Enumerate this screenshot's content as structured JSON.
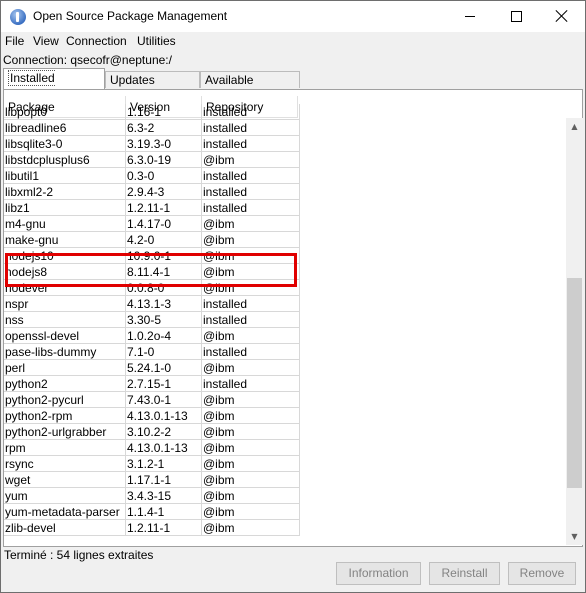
{
  "window": {
    "title": "Open Source Package Management"
  },
  "menu": [
    "File",
    "View",
    "Connection",
    "Utilities"
  ],
  "connection_label": "Connection: qsecofr@neptune:/",
  "tabs": [
    "Installed packages",
    "Updates available",
    "Available packages"
  ],
  "active_tab": "Installed packages",
  "table": {
    "columns": [
      "Package",
      "Version",
      "Repository"
    ],
    "rows": [
      [
        "libpopt0",
        "1.16-1",
        "installed"
      ],
      [
        "libreadline6",
        "6.3-2",
        "installed"
      ],
      [
        "libsqlite3-0",
        "3.19.3-0",
        "installed"
      ],
      [
        "libstdcplusplus6",
        "6.3.0-19",
        "@ibm"
      ],
      [
        "libutil1",
        "0.3-0",
        "installed"
      ],
      [
        "libxml2-2",
        "2.9.4-3",
        "installed"
      ],
      [
        "libz1",
        "1.2.11-1",
        "installed"
      ],
      [
        "m4-gnu",
        "1.4.17-0",
        "@ibm"
      ],
      [
        "make-gnu",
        "4.2-0",
        "@ibm"
      ],
      [
        "nodejs10",
        "10.9.0-1",
        "@ibm"
      ],
      [
        "nodejs8",
        "8.11.4-1",
        "@ibm"
      ],
      [
        "nodever",
        "0.0.8-0",
        "@ibm"
      ],
      [
        "nspr",
        "4.13.1-3",
        "installed"
      ],
      [
        "nss",
        "3.30-5",
        "installed"
      ],
      [
        "openssl-devel",
        "1.0.2o-4",
        "@ibm"
      ],
      [
        "pase-libs-dummy",
        "7.1-0",
        "installed"
      ],
      [
        "perl",
        "5.24.1-0",
        "@ibm"
      ],
      [
        "python2",
        "2.7.15-1",
        "installed"
      ],
      [
        "python2-pycurl",
        "7.43.0-1",
        "@ibm"
      ],
      [
        "python2-rpm",
        "4.13.0.1-13",
        "@ibm"
      ],
      [
        "python2-urlgrabber",
        "3.10.2-2",
        "@ibm"
      ],
      [
        "rpm",
        "4.13.0.1-13",
        "@ibm"
      ],
      [
        "rsync",
        "3.1.2-1",
        "@ibm"
      ],
      [
        "wget",
        "1.17.1-1",
        "@ibm"
      ],
      [
        "yum",
        "3.4.3-15",
        "@ibm"
      ],
      [
        "yum-metadata-parser",
        "1.1.4-1",
        "@ibm"
      ],
      [
        "zlib-devel",
        "1.2.11-1",
        "@ibm"
      ]
    ],
    "highlighted_rows": [
      "nodejs10",
      "nodejs8"
    ],
    "scroll_position": 0.78
  },
  "status_text": "Terminé : 54 lignes extraites",
  "buttons": {
    "information": "Information",
    "reinstall": "Reinstall",
    "remove": "Remove"
  },
  "colors": {
    "highlight": "#e00000",
    "disabled_text": "#838383"
  }
}
